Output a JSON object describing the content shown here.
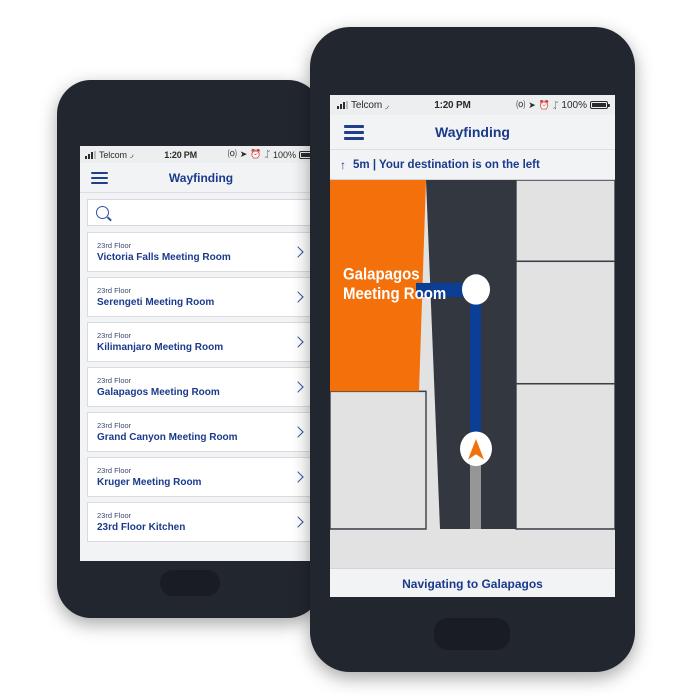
{
  "statusbar": {
    "carrier": "Telcom",
    "time": "1:20 PM",
    "battery_percent": "100%",
    "icons": [
      "signal-bars-icon",
      "wifi-icon",
      "rotation-lock-icon",
      "location-arrow-icon",
      "alarm-clock-icon",
      "bluetooth-icon",
      "battery-icon"
    ],
    "rotation_lock_glyph": "⒪",
    "location_glyph": "➤",
    "alarm_glyph": "⏰",
    "bluetooth_glyph": "ᛢ",
    "wifi_glyph": "◞"
  },
  "app": {
    "title": "Wayfinding",
    "menu_label": "Menu"
  },
  "search": {
    "value": "",
    "placeholder": ""
  },
  "list": {
    "items": [
      {
        "floor": "23rd Floor",
        "name": "Victoria Falls Meeting Room"
      },
      {
        "floor": "23rd Floor",
        "name": "Serengeti Meeting Room"
      },
      {
        "floor": "23rd Floor",
        "name": "Kilimanjaro Meeting Room"
      },
      {
        "floor": "23rd Floor",
        "name": "Galapagos Meeting Room"
      },
      {
        "floor": "23rd Floor",
        "name": "Grand Canyon Meeting Room"
      },
      {
        "floor": "23rd Floor",
        "name": "Kruger Meeting Room"
      },
      {
        "floor": "23rd Floor",
        "name": "23rd Floor Kitchen"
      }
    ]
  },
  "navigation": {
    "arrow_glyph": "↑",
    "instruction": "5m | Your destination is on the left",
    "distance": "5m",
    "direction_text": "Your destination is on the left",
    "footer_status": "Navigating to Galapagos"
  },
  "map": {
    "destination_room_label": "Galapagos\nMeeting Room",
    "destination_room_line1": "Galapagos",
    "destination_room_line2": "Meeting Room",
    "colors": {
      "destination_room": "#F4700A",
      "corridor": "#333740",
      "room_fill": "#E2E2E2",
      "route_remaining": "#0B3F96",
      "route_traveled": "#969696",
      "destination_dot": "#FFFFFF",
      "user_arrow": "#F4700A"
    }
  },
  "colors": {
    "brand_navy": "#1B3A8C",
    "accent_orange": "#F4700A",
    "phone_body": "#22262F",
    "screen_bg": "#F2F3F5"
  }
}
